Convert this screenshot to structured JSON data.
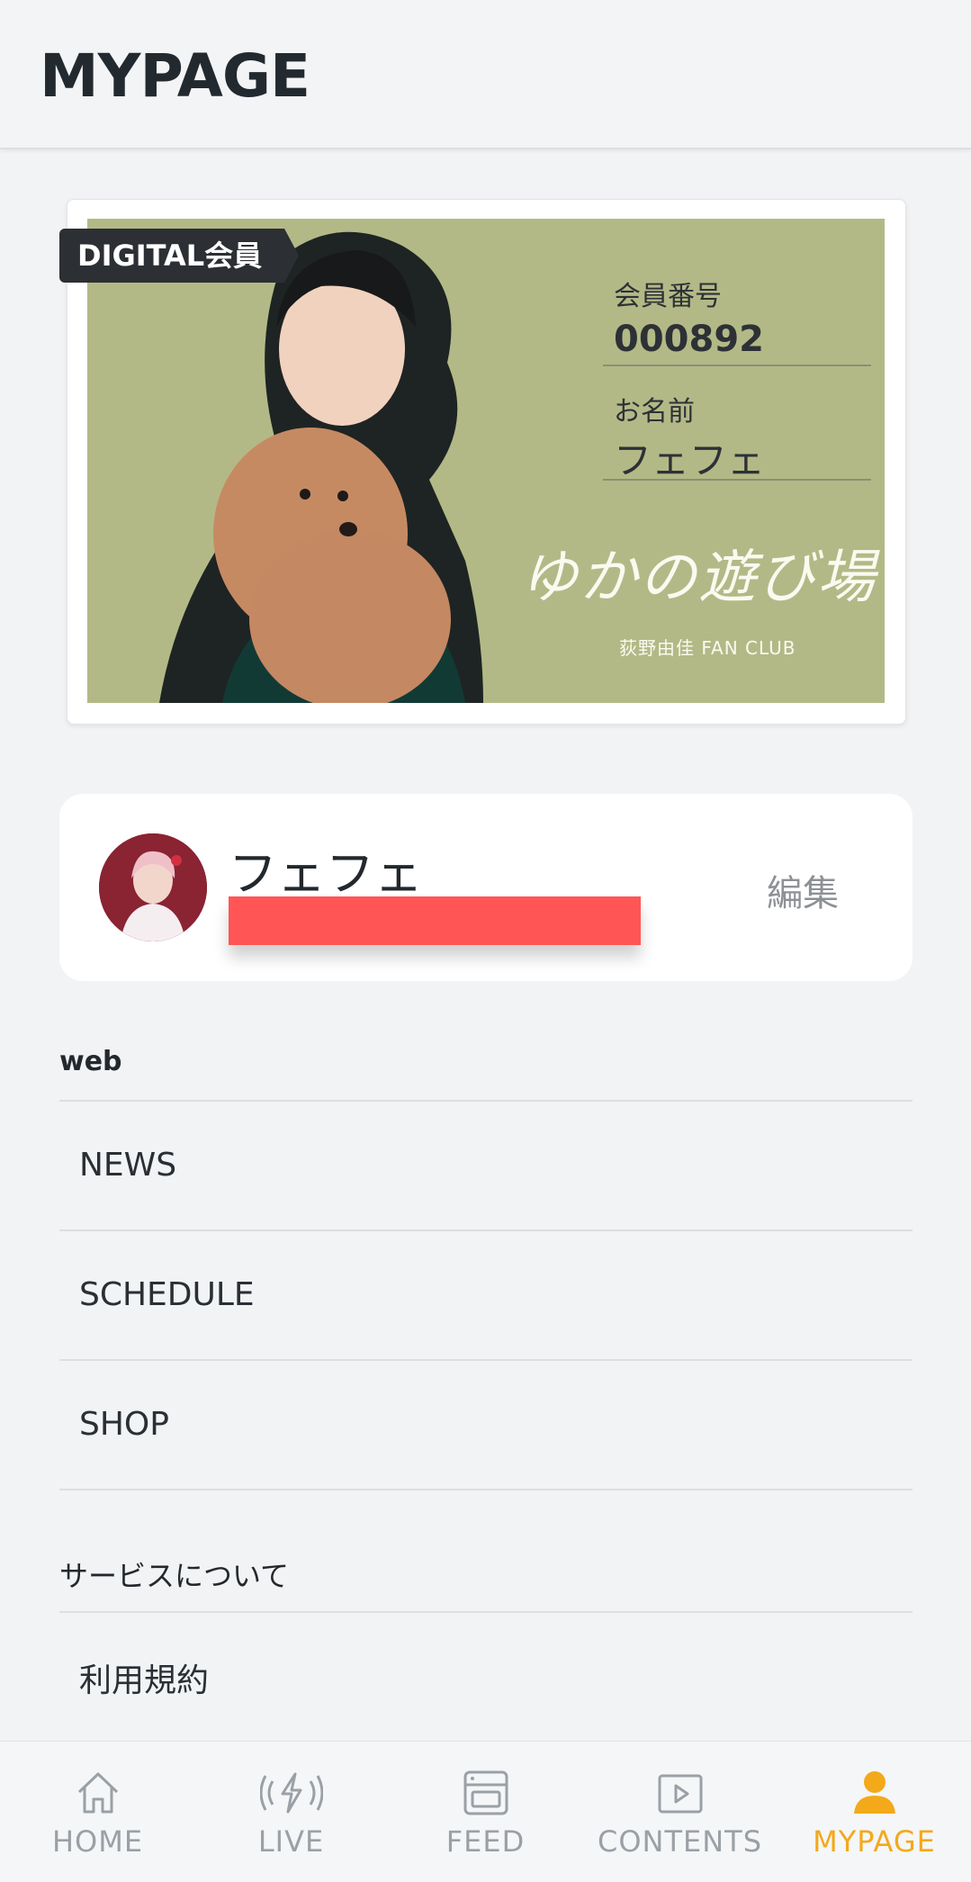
{
  "header": {
    "title": "MYPAGE"
  },
  "member_card": {
    "badge": "DIGITAL会員",
    "number_label": "会員番号",
    "number_value": "000892",
    "name_label": "お名前",
    "name_value": "フェフェ",
    "logo_title": "ゆかの遊び場",
    "logo_subtitle": "荻野由佳 FAN CLUB"
  },
  "profile": {
    "name": "フェフェ",
    "edit_label": "編集"
  },
  "menu": {
    "web_section": "web",
    "web_items": [
      "NEWS",
      "SCHEDULE",
      "SHOP"
    ],
    "service_section": "サービスについて",
    "service_items": [
      "利用規約"
    ]
  },
  "bottom_nav": {
    "items": [
      {
        "label": "HOME",
        "icon": "home-icon"
      },
      {
        "label": "LIVE",
        "icon": "live-icon"
      },
      {
        "label": "FEED",
        "icon": "feed-icon"
      },
      {
        "label": "CONTENTS",
        "icon": "contents-icon"
      },
      {
        "label": "MYPAGE",
        "icon": "user-icon"
      }
    ],
    "active_index": 4,
    "active_color": "#f3a91a",
    "inactive_color": "#9aa0a6"
  }
}
